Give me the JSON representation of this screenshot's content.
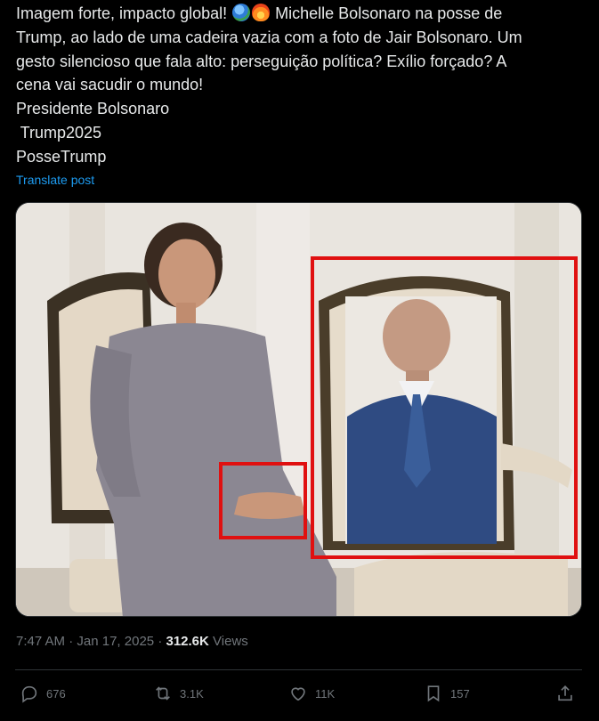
{
  "post": {
    "lines": [
      "Imagem forte, impacto global!",
      "Michelle Bolsonaro na posse de",
      "Trump, ao lado de uma cadeira vazia com a foto de Jair Bolsonaro. Um",
      "gesto silencioso que fala alto: perseguição política? Exílio forçado? A",
      "cena vai sacudir o mundo!",
      "Presidente Bolsonaro",
      " Trump2025",
      "PosseTrump"
    ],
    "emojis": [
      "globe-emoji",
      "fire-emoji"
    ],
    "translate_label": "Translate post"
  },
  "meta": {
    "time": "7:47 AM",
    "separator": "·",
    "date": "Jan 17, 2025",
    "views_count": "312.6K",
    "views_label": "Views"
  },
  "actions": {
    "reply": {
      "icon": "reply-icon",
      "count": "676"
    },
    "repost": {
      "icon": "repost-icon",
      "count": "3.1K"
    },
    "like": {
      "icon": "heart-icon",
      "count": "11K"
    },
    "bookmark": {
      "icon": "bookmark-icon",
      "count": "157"
    },
    "share": {
      "icon": "share-icon"
    }
  },
  "colors": {
    "background": "#000000",
    "text": "#e7e9ea",
    "muted": "#71767b",
    "link": "#1d9bf0",
    "highlight_box": "#e01010"
  }
}
